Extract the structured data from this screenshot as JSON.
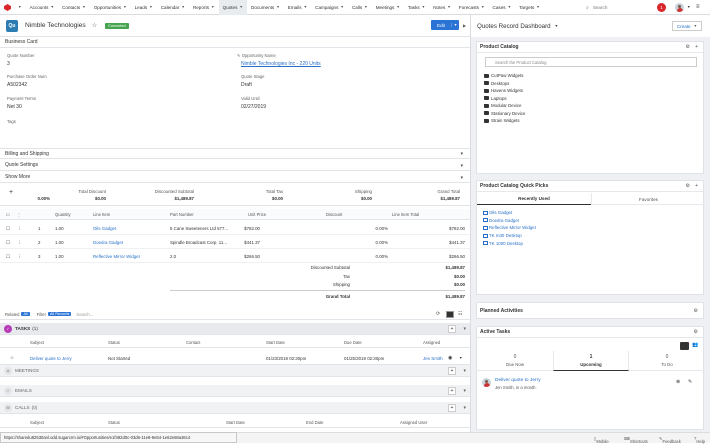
{
  "nav": {
    "items": [
      "Accounts",
      "Contacts",
      "Opportunities",
      "Leads",
      "Calendar",
      "Reports",
      "Quotes",
      "Documents",
      "Emails",
      "Campaigns",
      "Calls",
      "Meetings",
      "Tasks",
      "Notes",
      "Forecasts",
      "Cases",
      "Targets"
    ],
    "active": "Quotes",
    "search_placeholder": "Search",
    "notification_count": "1"
  },
  "record": {
    "icon_text": "Qu",
    "title": "Nimble Technologies",
    "status_badge": "Converted",
    "edit_label": "Edit"
  },
  "business_card": {
    "header": "Business Card",
    "quote_number_label": "Quote Number",
    "quote_number": "3",
    "opportunity_label": "Opportunity Name",
    "opportunity": "Nimble Technologies Inc - 220 Units",
    "po_label": "Purchase Order Num",
    "po": "A502342",
    "quote_stage_label": "Quote Stage",
    "quote_stage": "Draft",
    "payment_terms_label": "Payment Terms",
    "payment_terms": "Net 30",
    "valid_until_label": "Valid Until",
    "valid_until": "02/27/2019",
    "tags_label": "Tags"
  },
  "sections": {
    "billing": "Billing and Shipping",
    "quote_settings": "Quote Settings",
    "show_more": "Show More"
  },
  "totals": {
    "pct": "0.00%",
    "total_discount_label": "Total Discount",
    "total_discount": "$0.00",
    "discounted_subtotal_label": "Discounted Subtotal",
    "discounted_subtotal": "$1,489.87",
    "total_tax_label": "Total Tax",
    "total_tax": "$0.00",
    "shipping_label": "Shipping",
    "shipping": "$0.00",
    "grand_total_label": "Grand Total",
    "grand_total": "$1,489.87"
  },
  "line_items": {
    "headers": {
      "quantity": "Quantity",
      "line_item": "Line Item",
      "part_number": "Part Number",
      "unit_price": "Unit Price",
      "discount": "Discount",
      "line_item_total": "Line Item Total"
    },
    "rows": [
      {
        "num": "1",
        "qty": "1.00",
        "name": "Oils Gadget",
        "part": "5 Cane Sweeteners Ltd 577...",
        "price": "$782.00",
        "discount": "0.00%",
        "total": "$782.00"
      },
      {
        "num": "2",
        "qty": "1.00",
        "name": "Doedra Gadget",
        "part": "Spindle Broadcast Corp. 11...",
        "price": "$441.37",
        "discount": "0.00%",
        "total": "$441.37"
      },
      {
        "num": "3",
        "qty": "1.00",
        "name": "Reflective Mirror Widget",
        "part": "2.0",
        "price": "$266.50",
        "discount": "0.00%",
        "total": "$266.50"
      }
    ],
    "summary": [
      {
        "label": "Discounted Subtotal",
        "value": "$1,489.87"
      },
      {
        "label": "Tax",
        "value": "$0.00"
      },
      {
        "label": "Shipping",
        "value": "$0.00"
      }
    ]
  },
  "related": {
    "related_label": "Related",
    "related_pill": "All",
    "filter_label": "Filter",
    "filter_pill": "All Records",
    "search_placeholder": "Search..."
  },
  "tasks": {
    "title": "TASKS",
    "count": "(1)",
    "headers": {
      "subject": "Subject",
      "status": "Status",
      "contact": "Contact",
      "start": "Start Date",
      "due": "Due Date",
      "assigned": "Assigned"
    },
    "row": {
      "subject": "Deliver quote to Jerry",
      "status": "Not Started",
      "start": "01/23/2019 02:30pm",
      "due": "01/25/2019 02:30pm",
      "assigned": "Jen Smith"
    }
  },
  "meetings": {
    "title": "MEETINGS"
  },
  "emails": {
    "title": "EMAILS"
  },
  "calls": {
    "title": "CALLS",
    "count": "(0)",
    "headers": {
      "subject": "Subject",
      "status": "Status",
      "start": "Start Date",
      "end": "End Date",
      "assigned": "Assigned User"
    }
  },
  "status_url": "https://sharedu82530anl.odd.sugarcrm.io/#Opportunities/e1f492d0c-03d6-11e9-9e54-1e62e58a36c4",
  "footer": {
    "logo": "SUGAR",
    "mobile": "Mobile",
    "shortcuts": "Shortcuts",
    "feedback": "Feedback",
    "help": "Help"
  },
  "dashboard": {
    "title": "Quotes Record Dashboard",
    "create_label": "Create",
    "product_catalog": {
      "title": "Product Catalog",
      "search_placeholder": "Search the Product Catalog",
      "folders": [
        "CutPaw Widgets",
        "Desktops",
        "Havens Widgets",
        "Laptops",
        "Modular Device",
        "Stationary Device",
        "Strain Widgets"
      ]
    },
    "quick_picks": {
      "title": "Product Catalog Quick Picks",
      "tab_recent": "Recently Used",
      "tab_fav": "Favorites",
      "items": [
        "Oils Gadget",
        "Doedra Gadget",
        "Reflective Mirror Widget",
        "TK m30 Desktop",
        "TK 1000 Desktop"
      ]
    },
    "planned_activities": {
      "title": "Planned Activities"
    },
    "active_tasks": {
      "title": "Active Tasks",
      "tabs": [
        {
          "n": "0",
          "label": "Due Now"
        },
        {
          "n": "1",
          "label": "Upcoming"
        },
        {
          "n": "0",
          "label": "To Do"
        }
      ],
      "task_subject": "Deliver quote to Jerry",
      "task_meta": "Jen Smith, in a month."
    }
  },
  "colors": {
    "accent": "#2b73d4",
    "converted": "#46a44e",
    "notification": "#d9262a"
  }
}
